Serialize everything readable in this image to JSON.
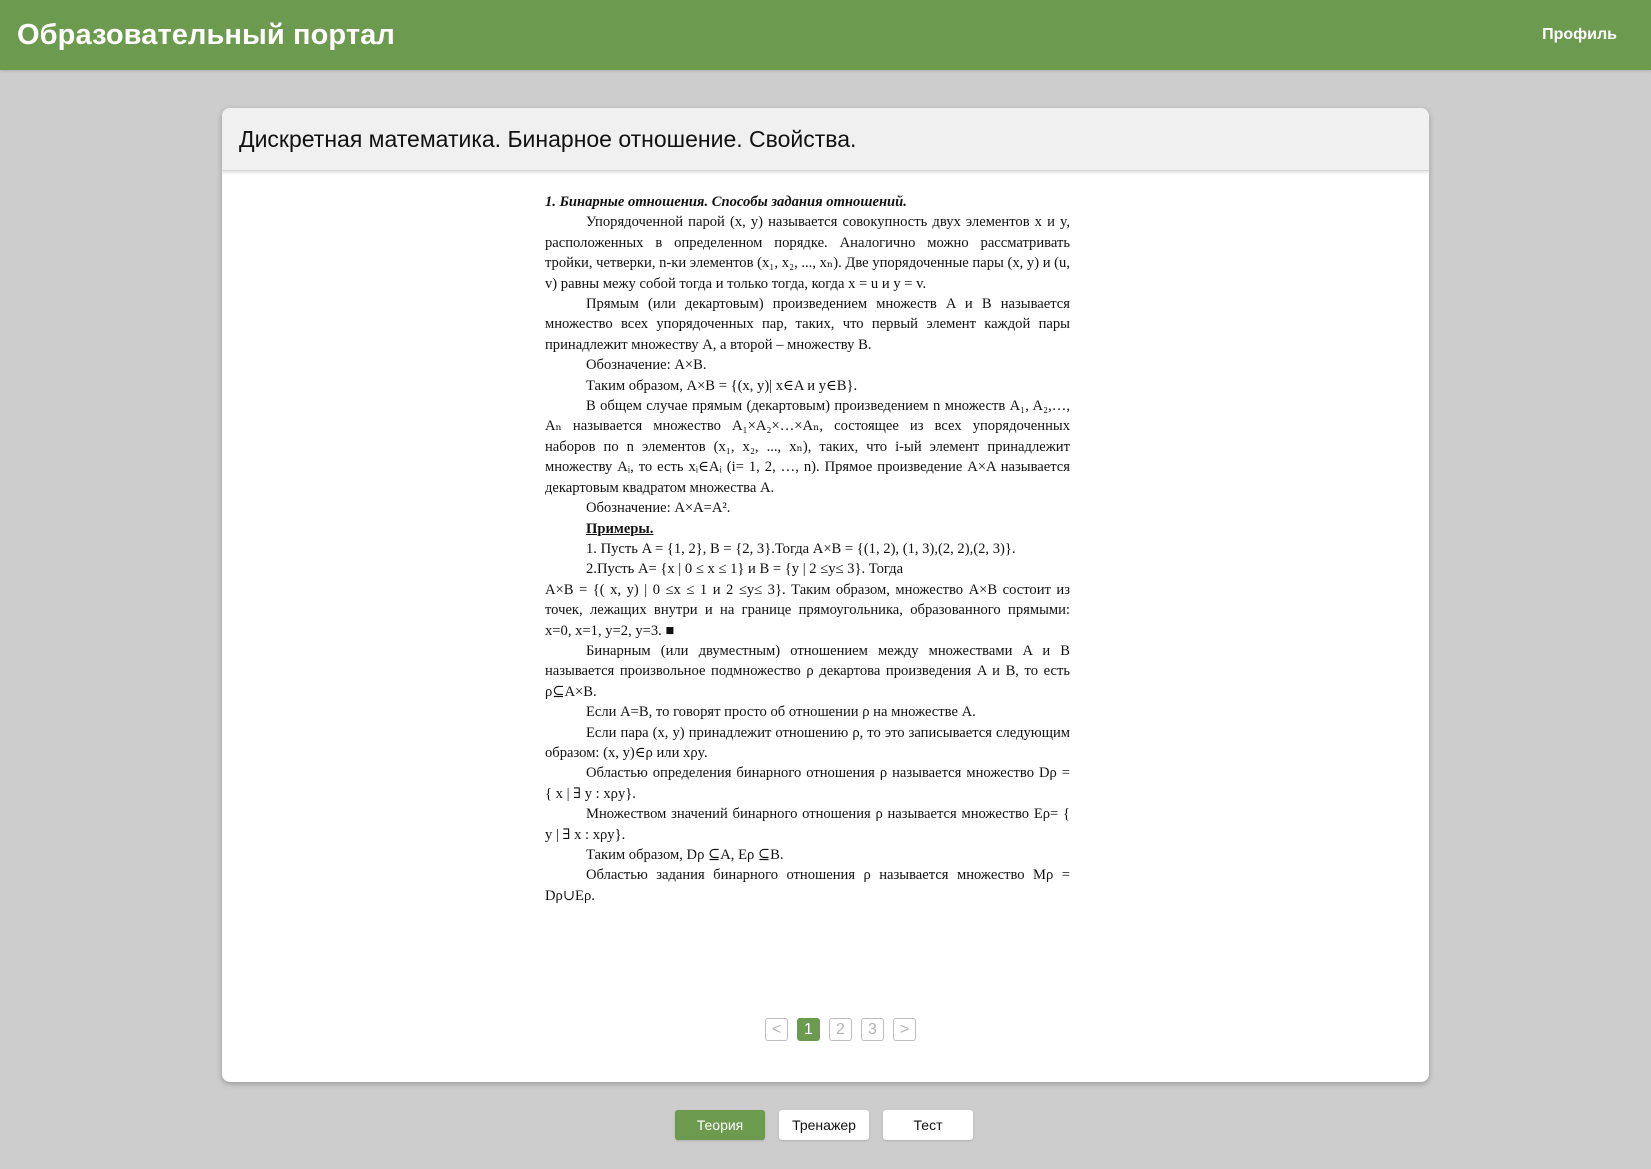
{
  "header": {
    "title": "Образовательный портал",
    "profile_label": "Профиль"
  },
  "lesson": {
    "title": "Дискретная математика. Бинарное отношение. Свойства."
  },
  "document": {
    "heading": "1. Бинарные отношения. Способы задания отношений.",
    "paragraphs": [
      "Упорядоченной парой (x, y) называется совокупность двух элементов x и y, расположенных в определенном порядке. Аналогично можно рассматривать тройки, четверки, n-ки элементов (x₁, x₂, ..., xₙ). Две упорядоченные пары (x, y) и (u, v) равны межу собой тогда и только тогда, когда   x = u и  y = v.",
      "Прямым (или декартовым) произведением множеств A и B называется множество всех упорядоченных пар, таких, что первый элемент каждой пары принадлежит множеству A, а второй – множеству B.",
      "Обозначение:  A×B.",
      "Таким образом,  A×B = {(x, y)| x∈A и y∈B}.",
      "В общем случае прямым (декартовым) произведением n множеств A₁, A₂,…, Aₙ называется множество A₁×A₂×…×Aₙ, состоящее из всех упорядоченных наборов по n элементов (x₁, x₂, ..., xₙ), таких, что i-ый элемент принадлежит множеству Aᵢ, то есть  xᵢ∈Aᵢ (i= 1, 2, …, n). Прямое произведение A×A называется декартовым квадратом множества A.",
      "Обозначение:  A×A=A².",
      "Примеры.",
      "1. Пусть A = {1, 2}, B = {2, 3}.Тогда A×B = {(1, 2), (1, 3),(2, 2),(2, 3)}.",
      "2.Пусть  A= {x | 0 ≤ x ≤ 1} и B = {y | 2 ≤y≤ 3}. Тогда",
      "A×B = {( x, y) | 0 ≤x ≤ 1 и 2 ≤y≤ 3}. Таким образом, множество A×B состоит из точек, лежащих внутри и на границе прямоугольника, образованного прямыми: x=0, x=1, y=2,  y=3. ■",
      "Бинарным (или двуместным) отношением  между множествами A и B называется произвольное подмножество ρ декартова произведения A и B, то есть  ρ⊆A×B.",
      "Если A=B, то говорят просто об отношении  ρ  на множестве A.",
      "Если пара (x, y) принадлежит отношению ρ, то это записывается следующим образом: (x, y)∈ρ  или  xρy.",
      "Областью определения бинарного отношения ρ называется множество Dρ = { x | ∃ y :  xρy}.",
      "Множеством значений бинарного отношения ρ называется множество Eρ= { y | ∃ x :  xρy}.",
      "Таким образом, Dρ ⊆A, Eρ ⊆B.",
      "Областью задания бинарного отношения ρ называется множество Mρ = Dρ∪Eρ."
    ]
  },
  "pagination": {
    "prev_label": "<",
    "next_label": ">",
    "pages": [
      "1",
      "2",
      "3"
    ],
    "current_page": 1
  },
  "bottom_tabs": {
    "theory_label": "Теория",
    "trainer_label": "Тренажер",
    "test_label": "Тест",
    "active": "Теория"
  },
  "colors": {
    "accent": "#6c9b50",
    "background": "#cdcdcd"
  }
}
